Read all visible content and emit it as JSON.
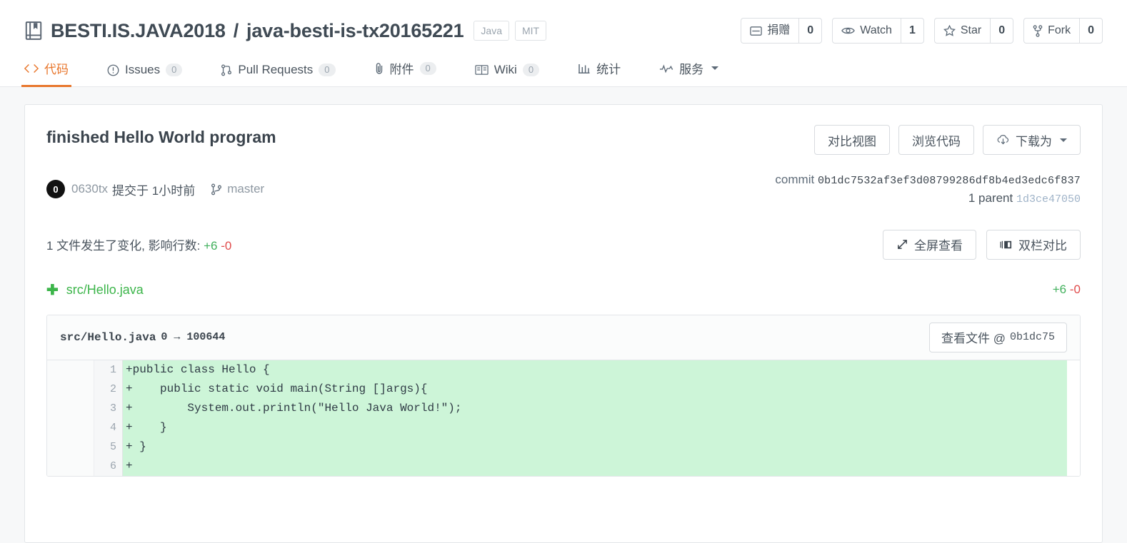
{
  "header": {
    "repo_icon": "book-icon",
    "owner": "BESTI.IS.JAVA2018",
    "separator": "/",
    "name": "java-besti-is-tx20165221",
    "badges": [
      {
        "label": "Java"
      },
      {
        "label": "MIT"
      }
    ],
    "actions": [
      {
        "icon": "donate-icon",
        "label": "捐赠",
        "count": "0"
      },
      {
        "icon": "eye-icon",
        "label": "Watch",
        "count": "1"
      },
      {
        "icon": "star-icon",
        "label": "Star",
        "count": "0"
      },
      {
        "icon": "fork-icon",
        "label": "Fork",
        "count": "0"
      }
    ]
  },
  "nav": {
    "tabs": [
      {
        "icon": "code-icon",
        "label": "代码",
        "count": null,
        "active": true
      },
      {
        "icon": "issue-opened-icon",
        "label": "Issues",
        "count": "0",
        "active": false
      },
      {
        "icon": "pull-request-icon",
        "label": "Pull Requests",
        "count": "0",
        "active": false
      },
      {
        "icon": "paperclip-icon",
        "label": "附件",
        "count": "0",
        "active": false
      },
      {
        "icon": "book-open-icon",
        "label": "Wiki",
        "count": "0",
        "active": false
      },
      {
        "icon": "graph-icon",
        "label": "统计",
        "count": null,
        "active": false
      },
      {
        "icon": "pulse-icon",
        "label": "服务",
        "count": null,
        "active": false,
        "dropdown": true
      }
    ]
  },
  "commit": {
    "title": "finished Hello World program",
    "head_actions": [
      {
        "label": "对比视图",
        "icon": null
      },
      {
        "label": "浏览代码",
        "icon": null
      },
      {
        "label": "下载为",
        "icon": "cloud-download-icon",
        "dropdown": true
      }
    ],
    "avatar_text": "0",
    "author": "0630tx",
    "when": "提交于 1小时前",
    "branch_icon": "git-branch-icon",
    "branch": "master",
    "commit_label": "commit",
    "commit_sha": "0b1dc7532af3ef3d08799286df8b4ed3edc6f837",
    "parent_label": "1 parent",
    "parent_sha": "1d3ce47050"
  },
  "diffstat": {
    "text_prefix": "1 文件发生了变化, 影响行数:",
    "additions": "+6",
    "deletions": "-0",
    "actions": [
      {
        "label": "全屏查看",
        "icon": "expand-icon"
      },
      {
        "label": "双栏对比",
        "icon": "split-view-icon"
      }
    ]
  },
  "file": {
    "status_icon": "plus-icon",
    "path": "src/Hello.java",
    "additions": "+6",
    "deletions": "-0"
  },
  "diff": {
    "header_path": "src/Hello.java",
    "header_mode": "0 → 100644",
    "view_file_label": "查看文件 @",
    "view_file_sha": "0b1dc75",
    "lines": [
      {
        "num": "1",
        "marker": "+",
        "code": "public class Hello {"
      },
      {
        "num": "2",
        "marker": "+",
        "code": "    public static void main(String []args){"
      },
      {
        "num": "3",
        "marker": "+",
        "code": "        System.out.println(\"Hello Java World!\");"
      },
      {
        "num": "4",
        "marker": "+",
        "code": "    }"
      },
      {
        "num": "5",
        "marker": "+",
        "code": " }"
      },
      {
        "num": "6",
        "marker": "+",
        "code": ""
      }
    ]
  },
  "colors": {
    "accent": "#e8762c",
    "addition": "#41b05c",
    "deletion": "#e04b4b",
    "diff_add_bg": "#cdf5d8",
    "file_green": "#3cb54a"
  }
}
